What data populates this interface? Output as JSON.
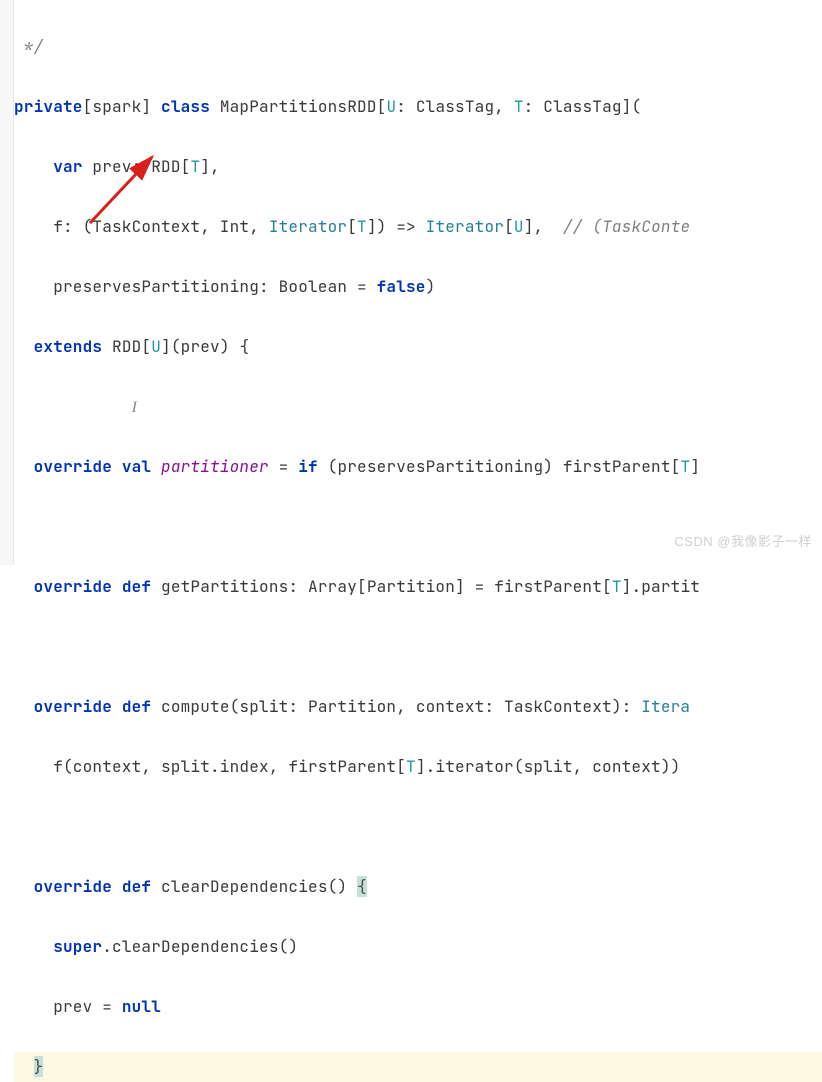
{
  "code": {
    "l0": " */",
    "l1_kw1": "private",
    "l1_scope": "[spark] ",
    "l1_kw2": "class",
    "l1_name": " MapPartitionsRDD[",
    "l1_u": "U",
    "l1_mid1": ": ClassTag, ",
    "l1_t": "T",
    "l1_end": ": ClassTag](",
    "l2_kw": "var",
    "l2_name": " prev: ",
    "l2_type": "RDD",
    "l2_mid": "[",
    "l2_t": "T",
    "l2_end": "],",
    "l3_name": "    f: (TaskContext, Int, ",
    "l3_it1": "Iterator",
    "l3_mid1": "[",
    "l3_t": "T",
    "l3_mid2": "]) => ",
    "l3_it2": "Iterator",
    "l3_mid3": "[",
    "l3_u": "U",
    "l3_mid4": "],  ",
    "l3_comment": "// (TaskConte",
    "l4_pre": "    preservesPartitioning: Boolean = ",
    "l4_kw": "false",
    "l4_end": ")",
    "l5_kw": "extends",
    "l5_name": " RDD[",
    "l5_u": "U",
    "l5_end": "](prev) {",
    "l7_kw1": "override",
    "l7_kw2": " val ",
    "l7_member": "partitioner",
    "l7_mid": " = ",
    "l7_kw3": "if",
    "l7_end": " (preservesPartitioning) firstParent[",
    "l7_t": "T",
    "l7_tail": "]",
    "l9_kw1": "override",
    "l9_kw2": " def ",
    "l9_name": "getPartitions: Array[Partition] = firstParent[",
    "l9_t": "T",
    "l9_end": "].partit",
    "l11_kw1": "override",
    "l11_kw2": " def ",
    "l11_name": "compute(split: Partition, context: TaskContext): ",
    "l11_type": "Itera",
    "l12": "  f(context, split.index, firstParent[",
    "l12_t": "T",
    "l12_end": "].iterator(split, context))",
    "l14_kw1": "override",
    "l14_kw2": " def ",
    "l14_name": "clearDependencies() ",
    "l14_brace": "{",
    "l15_kw": "super",
    "l15_end": ".clearDependencies()",
    "l16_pre": "  prev = ",
    "l16_kw": "null",
    "l17_brace": "}"
  },
  "watermark": "CSDN @我像影子一样"
}
